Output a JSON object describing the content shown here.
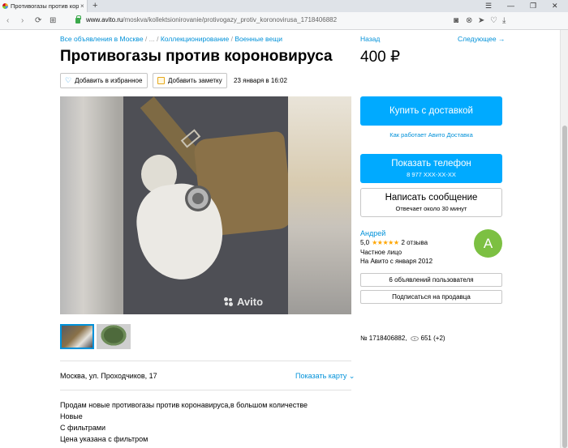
{
  "browser": {
    "tab_title": "Противогазы против кор",
    "tab_close": "×",
    "new_tab": "+",
    "url_host": "www.avito.ru",
    "url_path": "/moskva/kollektsionirovanie/protivogazy_protiv_koronovirusa_1718406882",
    "window_buttons": [
      "☰",
      "—",
      "❐",
      "✕"
    ],
    "nav": {
      "back": "‹",
      "forward": "›",
      "reload": "⟳",
      "grid": "⊞"
    },
    "tools": [
      "◙",
      "⊗",
      "➤",
      "♡",
      "⤓"
    ]
  },
  "breadcrumbs": {
    "part1": "Все объявления в Москве",
    "sep1": " / ... / ",
    "part2": "Коллекционирование",
    "sep2": " / ",
    "part3": "Военные вещи"
  },
  "listing": {
    "title": "Противогазы против короновируса",
    "price": "400 ₽",
    "favorite_label": "Добавить в избранное",
    "note_label": "Добавить заметку",
    "date": "23 января в 16:02",
    "watermark": "Avito"
  },
  "navigation": {
    "back": "Назад",
    "next": "Следующее →"
  },
  "location": {
    "address": "Москва, ул. Проходчиков, 17",
    "show_map": "Показать карту ⌄"
  },
  "description": [
    "Продам новые противогазы против коронавируса,в большом количестве",
    "Новые",
    "С фильтрами",
    "Цена указана с фильтром"
  ],
  "actions": {
    "buy_label": "Купить с доставкой",
    "delivery_link": "Как работает Авито Доставка",
    "phone_label": "Показать телефон",
    "phone_masked": "8 977 XXX-XX-XX",
    "message_label": "Написать сообщение",
    "message_response": "Отвечает около 30 минут"
  },
  "seller": {
    "name": "Андрей",
    "rating": "5,0",
    "stars": "★★★★★",
    "reviews": "2 отзыва",
    "type": "Частное лицо",
    "since": "На Авито с января 2012",
    "avatar_letter": "А",
    "listings_button": "6 объявлений пользователя",
    "subscribe_button": "Подписаться на продавца"
  },
  "meta": {
    "item_number": "№ 1718406882,",
    "views": "651 (+2)"
  },
  "colors": {
    "link": "#0091d9",
    "primary_button": "#00aaff",
    "avatar": "#7cc042",
    "stars": "#ffa500"
  }
}
